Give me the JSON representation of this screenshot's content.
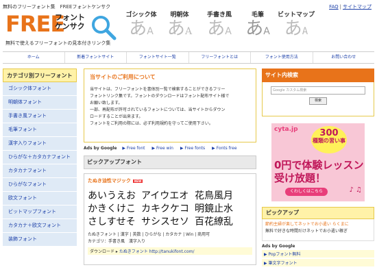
{
  "header": {
    "page_title": "無料のフリーフォント集　FREEフォントケンサク",
    "logo_free": "FREE",
    "logo_sub_line1": "フォント",
    "logo_sub_line2": "ケンサク",
    "tagline": "無料で使えるフリーフォントの見本付きリンク集",
    "top_links": [
      "FAQ",
      "サイトマップ"
    ],
    "font_samples": [
      {
        "label": "ゴシック体",
        "glyph": "あ",
        "small": "A"
      },
      {
        "label": "明朝体",
        "glyph": "あ",
        "small": "A"
      },
      {
        "label": "手書き風",
        "glyph": "あ",
        "small": "A"
      },
      {
        "label": "毛筆",
        "glyph": "あ",
        "small": "A"
      },
      {
        "label": "ビットマップ",
        "glyph": "あ",
        "small": "A"
      }
    ]
  },
  "nav": {
    "items": [
      "ホーム",
      "新着フォントサイト",
      "フォントサイト一覧",
      "フリーフォントとは",
      "フォント使用方法",
      "お問い合わせ"
    ]
  },
  "sidebar": {
    "title": "カテゴリ別フリーフォント",
    "items": [
      "ゴシック体フォント",
      "明朝体フォント",
      "手書き風フォント",
      "毛筆フォント",
      "漢字入りフォント",
      "ひらがな＋カタカナフォント",
      "カタカナフォント",
      "ひらがなフォント",
      "欧文フォント",
      "ビットマップフォント",
      "カタカナ＋欧文フォント",
      "装飾フォント"
    ]
  },
  "main": {
    "info_title": "当サイトのご利用について",
    "info_lines": [
      "当サイトは、フリーフォントを書体別一覧で検索することができるフリー",
      "フォントリンク集です。フォントのダウンロードはフォント配布サイト様で",
      "お願い致します。",
      "一部、再配布が許可されているフォントについては、当サイトからダウン",
      "ロードすることが出来ます。",
      "フォントをご利用の際には、必ず利用規約を守ってご使用下さい。"
    ],
    "ads_label": "Ads by Google",
    "ad_links": [
      "▶ Free font",
      "▶ Free win",
      "▶ Free fonts",
      "▶ Fonts free"
    ],
    "pickup_title": "ピックアップフォント",
    "card": {
      "name": "たぬき油性マジック",
      "badge": "NEW",
      "rows": [
        [
          "あいうえお",
          "アイウエオ",
          "花鳥風月"
        ],
        [
          "かきくけこ",
          "カキクケコ",
          "明鏡止水"
        ],
        [
          "さしすせそ",
          "サシスセソ",
          "百花繚乱"
        ]
      ],
      "meta_line1": "たぬきフォント | 漢字 | 英数 | ひらがな | カタカナ | Win | 商用可",
      "meta_line2": "カテゴリ：手書き風　漢字入り",
      "download_label": "ダウンロード ▸",
      "download_site": "たぬきフォント",
      "download_url": "http://tanukifont.com/"
    }
  },
  "right": {
    "search_title": "サイト内検索",
    "search_placeholder": "Google カスタム検索",
    "search_button": "検索",
    "ad": {
      "brand": "cyta.jp",
      "circle_num": "300",
      "circle_text": "種類の習い事",
      "big1": "0円で体験レッスン",
      "big2": "受け放題！",
      "cta": "くわしくはこちら"
    },
    "pickup_title": "ピックアップ",
    "pickup_link1": "節約主婦が楽してネットでお小遣い らくまに",
    "pickup_link2": "無料で好きな時間だけネットでお小遣い稼ぎ",
    "ads_label": "Ads by Google",
    "ad_lines": [
      "▶ Popフォント無料",
      "▶ 筆文字フォント"
    ]
  }
}
